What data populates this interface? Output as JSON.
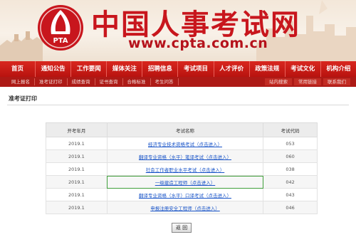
{
  "header": {
    "site_title": "中国人事考试网",
    "site_url": "www.cpta.com.cn",
    "logo_text": "PTA"
  },
  "main_nav": [
    {
      "label": "首页"
    },
    {
      "label": "通知公告"
    },
    {
      "label": "工作要闻"
    },
    {
      "label": "媒体关注"
    },
    {
      "label": "招聘信息"
    },
    {
      "label": "考试项目"
    },
    {
      "label": "人才评价"
    },
    {
      "label": "政策法规"
    },
    {
      "label": "考试文化"
    },
    {
      "label": "机构介绍"
    }
  ],
  "sub_nav_left": [
    {
      "label": "网上报名"
    },
    {
      "label": "准考证打印"
    },
    {
      "label": "成绩查询"
    },
    {
      "label": "证书查询"
    },
    {
      "label": "合格标准"
    },
    {
      "label": "考生问答"
    }
  ],
  "sub_nav_right": [
    {
      "label": "站内搜索"
    },
    {
      "label": "常用链接"
    },
    {
      "label": "联系我们"
    }
  ],
  "section_title": "准考证打印",
  "table": {
    "headers": {
      "year": "开考年月",
      "name": "考试名称",
      "code": "考试代码"
    },
    "rows": [
      {
        "year": "2019.1",
        "name": "经济专业技术资格考试（点击进入）",
        "code": "053"
      },
      {
        "year": "2019.1",
        "name": "翻译专业资格（水平）笔译考试（点击进入）",
        "code": "060"
      },
      {
        "year": "2019.1",
        "name": "社会工作者职业水平考试（点击进入）",
        "code": "038"
      },
      {
        "year": "2019.1",
        "name": "一级建造工程师（点击进入）",
        "code": "042"
      },
      {
        "year": "2019.1",
        "name": "翻译专业资格（水平）口译考试（点击进入）",
        "code": "043"
      },
      {
        "year": "2019.1",
        "name": "申报注册安全工程师（点击进入）",
        "code": "046"
      }
    ],
    "boxed_row": 3
  },
  "back_button": "返 回",
  "colors": {
    "brand_red": "#c8161d",
    "nav_red": "#c41a14",
    "link_blue": "#1a55c8",
    "highlight_green": "#3f9f3a"
  }
}
